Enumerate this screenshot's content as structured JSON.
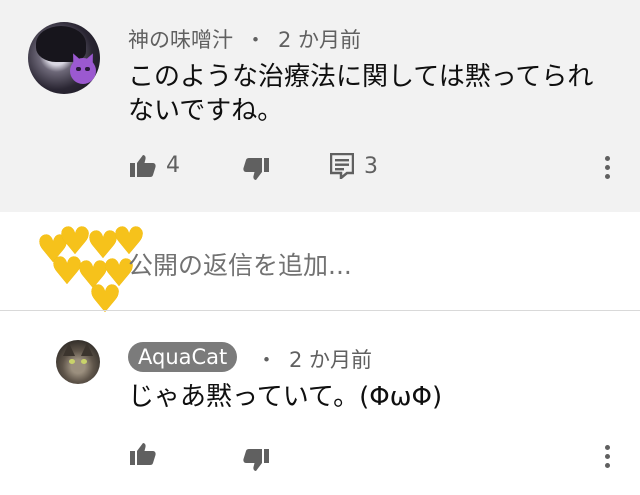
{
  "comment": {
    "author": "神の味噌汁",
    "separator": "・",
    "time": "2 か月前",
    "text": "このような治療法に関しては黙ってられないですね。",
    "likes": "4",
    "replies": "3",
    "icons": {
      "like": "thumbs-up-icon",
      "dislike": "thumbs-down-icon",
      "reply": "comment-icon",
      "more": "more-vert-icon"
    }
  },
  "reply_box": {
    "placeholder": "公開の返信を追加...",
    "avatar_icon": "yellow-hearts"
  },
  "reply": {
    "author": "AquaCat",
    "separator": "・",
    "time": "2 か月前",
    "text": "じゃあ黙っていて。(ΦωΦ)"
  },
  "colors": {
    "comment_bg": "#f2f2f2",
    "secondary_text": "#606060",
    "heart": "#f6c21b",
    "author_chip": "#7b7b7b"
  }
}
